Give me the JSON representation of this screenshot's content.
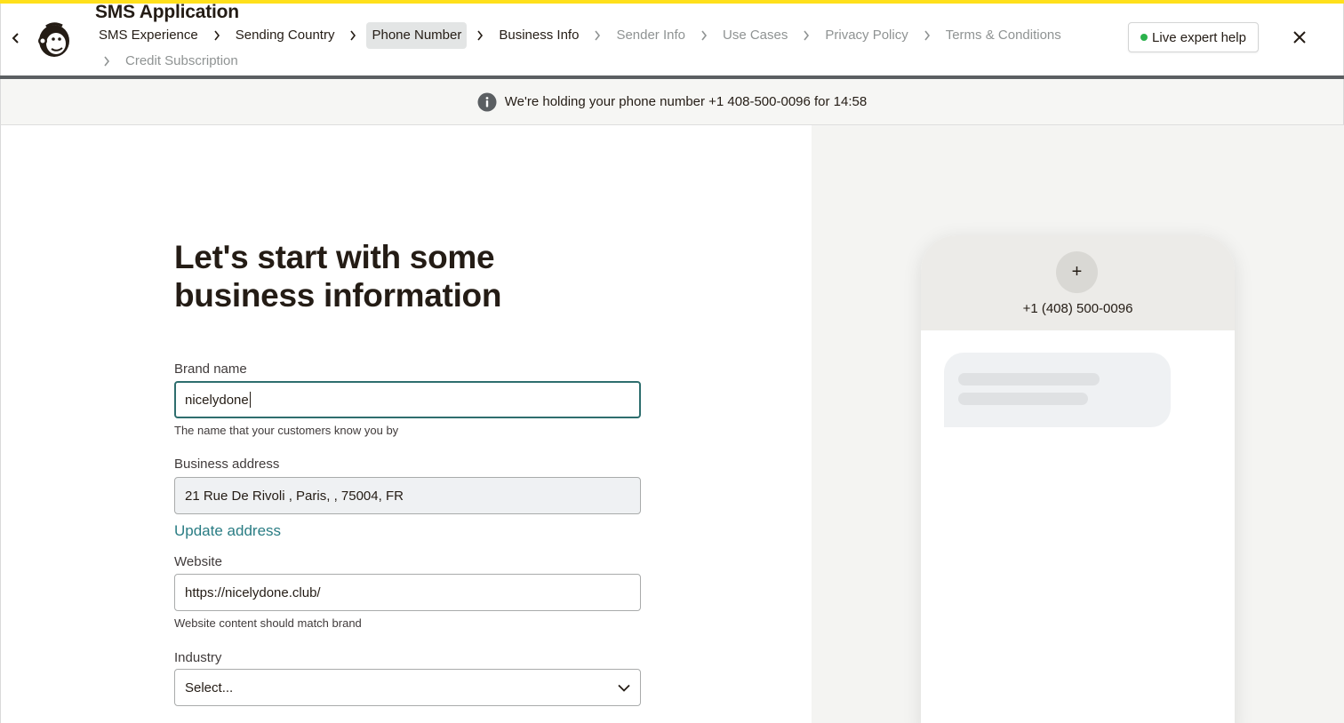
{
  "app": {
    "title": "SMS Application"
  },
  "colors": {
    "accent": "#ffe01b",
    "link": "#2a7d84",
    "focus": "#2e6e6e",
    "live_dot": "#2bb24c"
  },
  "icons": {
    "back": "chevron-left-icon",
    "logo": "mailchimp-freddie-logo",
    "separator": "chevron-right-icon",
    "close": "close-icon",
    "info": "info-icon",
    "dropdown": "chevron-down-icon",
    "avatar_add": "plus-icon"
  },
  "breadcrumbs": {
    "row1": [
      {
        "label": "SMS Experience",
        "state": "done"
      },
      {
        "label": "Sending Country",
        "state": "done"
      },
      {
        "label": "Phone Number",
        "state": "active"
      },
      {
        "label": "Business Info",
        "state": "done"
      },
      {
        "label": "Sender Info",
        "state": "future"
      },
      {
        "label": "Use Cases",
        "state": "future"
      },
      {
        "label": "Privacy Policy",
        "state": "future"
      },
      {
        "label": "Terms & Conditions",
        "state": "future"
      }
    ],
    "row2": [
      {
        "label": "Credit Subscription",
        "state": "future"
      }
    ]
  },
  "header": {
    "help_label": "Live expert help"
  },
  "banner": {
    "text": "We're holding your phone number +1 408-500-0096 for 14:58"
  },
  "form": {
    "title": "Let's start with some business information",
    "brand_name": {
      "label": "Brand name",
      "value": "nicelydone",
      "help": "The name that your customers know you by"
    },
    "business_address": {
      "label": "Business address",
      "value": "21 Rue De Rivoli , Paris, , 75004, FR",
      "update_link": "Update address"
    },
    "website": {
      "label": "Website",
      "value": "https://nicelydone.club/",
      "help": "Website content should match brand"
    },
    "industry": {
      "label": "Industry",
      "selected": "Select..."
    }
  },
  "preview": {
    "avatar_symbol": "+",
    "phone_number": "+1 (408) 500-0096"
  }
}
